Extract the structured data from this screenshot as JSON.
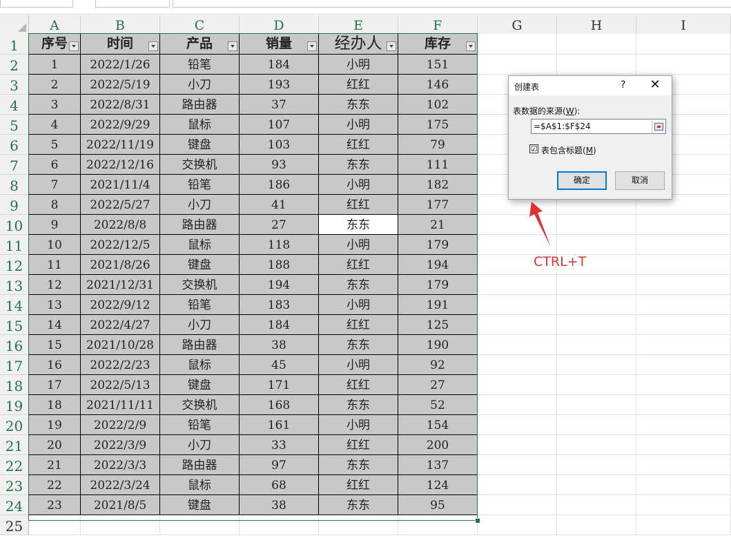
{
  "columns": [
    "A",
    "B",
    "C",
    "D",
    "E",
    "F",
    "G",
    "H",
    "I"
  ],
  "rows": [
    "1",
    "2",
    "3",
    "4",
    "5",
    "6",
    "7",
    "8",
    "9",
    "10",
    "11",
    "12",
    "13",
    "14",
    "15",
    "16",
    "17",
    "18",
    "19",
    "20",
    "21",
    "22",
    "23",
    "24",
    "25"
  ],
  "headers": [
    "序号",
    "时间",
    "产品",
    "销量",
    "经办人",
    "库存"
  ],
  "data": [
    [
      "1",
      "2022/1/26",
      "铅笔",
      "184",
      "小明",
      "151"
    ],
    [
      "2",
      "2022/5/19",
      "小刀",
      "193",
      "红红",
      "146"
    ],
    [
      "3",
      "2022/8/31",
      "路由器",
      "37",
      "东东",
      "102"
    ],
    [
      "4",
      "2022/9/29",
      "鼠标",
      "107",
      "小明",
      "175"
    ],
    [
      "5",
      "2022/11/19",
      "键盘",
      "103",
      "红红",
      "79"
    ],
    [
      "6",
      "2022/12/16",
      "交换机",
      "93",
      "东东",
      "111"
    ],
    [
      "7",
      "2021/11/4",
      "铅笔",
      "186",
      "小明",
      "182"
    ],
    [
      "8",
      "2022/5/27",
      "小刀",
      "41",
      "红红",
      "177"
    ],
    [
      "9",
      "2022/8/8",
      "路由器",
      "27",
      "东东",
      "21"
    ],
    [
      "10",
      "2022/12/5",
      "鼠标",
      "118",
      "小明",
      "179"
    ],
    [
      "11",
      "2021/8/26",
      "键盘",
      "188",
      "红红",
      "194"
    ],
    [
      "12",
      "2021/12/31",
      "交换机",
      "194",
      "东东",
      "179"
    ],
    [
      "13",
      "2022/9/12",
      "铅笔",
      "183",
      "小明",
      "191"
    ],
    [
      "14",
      "2022/4/27",
      "小刀",
      "184",
      "红红",
      "125"
    ],
    [
      "15",
      "2021/10/28",
      "路由器",
      "38",
      "东东",
      "190"
    ],
    [
      "16",
      "2022/2/23",
      "鼠标",
      "45",
      "小明",
      "92"
    ],
    [
      "17",
      "2022/5/13",
      "键盘",
      "171",
      "红红",
      "27"
    ],
    [
      "18",
      "2021/11/11",
      "交换机",
      "168",
      "东东",
      "52"
    ],
    [
      "19",
      "2022/2/9",
      "铅笔",
      "161",
      "小明",
      "154"
    ],
    [
      "20",
      "2022/3/9",
      "小刀",
      "33",
      "红红",
      "200"
    ],
    [
      "21",
      "2022/3/3",
      "路由器",
      "97",
      "东东",
      "137"
    ],
    [
      "22",
      "2022/3/24",
      "鼠标",
      "68",
      "红红",
      "124"
    ],
    [
      "23",
      "2021/8/5",
      "键盘",
      "38",
      "东东",
      "95"
    ]
  ],
  "active_cell": "E10",
  "dialog": {
    "title": "创建表",
    "help": "?",
    "close": "✕",
    "source_label_pre": "表数据的来源(",
    "source_label_key": "W",
    "source_label_post": "):",
    "range_value": "=$A$1:$F$24",
    "has_headers_pre": "表包含标题(",
    "has_headers_key": "M",
    "has_headers_post": ")",
    "has_headers_checked": "☑",
    "ok_label": "确定",
    "cancel_label": "取消"
  },
  "annotation": "CTRL+T",
  "colors": {
    "accent": "#217346",
    "table_fill": "#c8c8c8",
    "annotation": "#e03030",
    "ok_border": "#0078d7"
  }
}
